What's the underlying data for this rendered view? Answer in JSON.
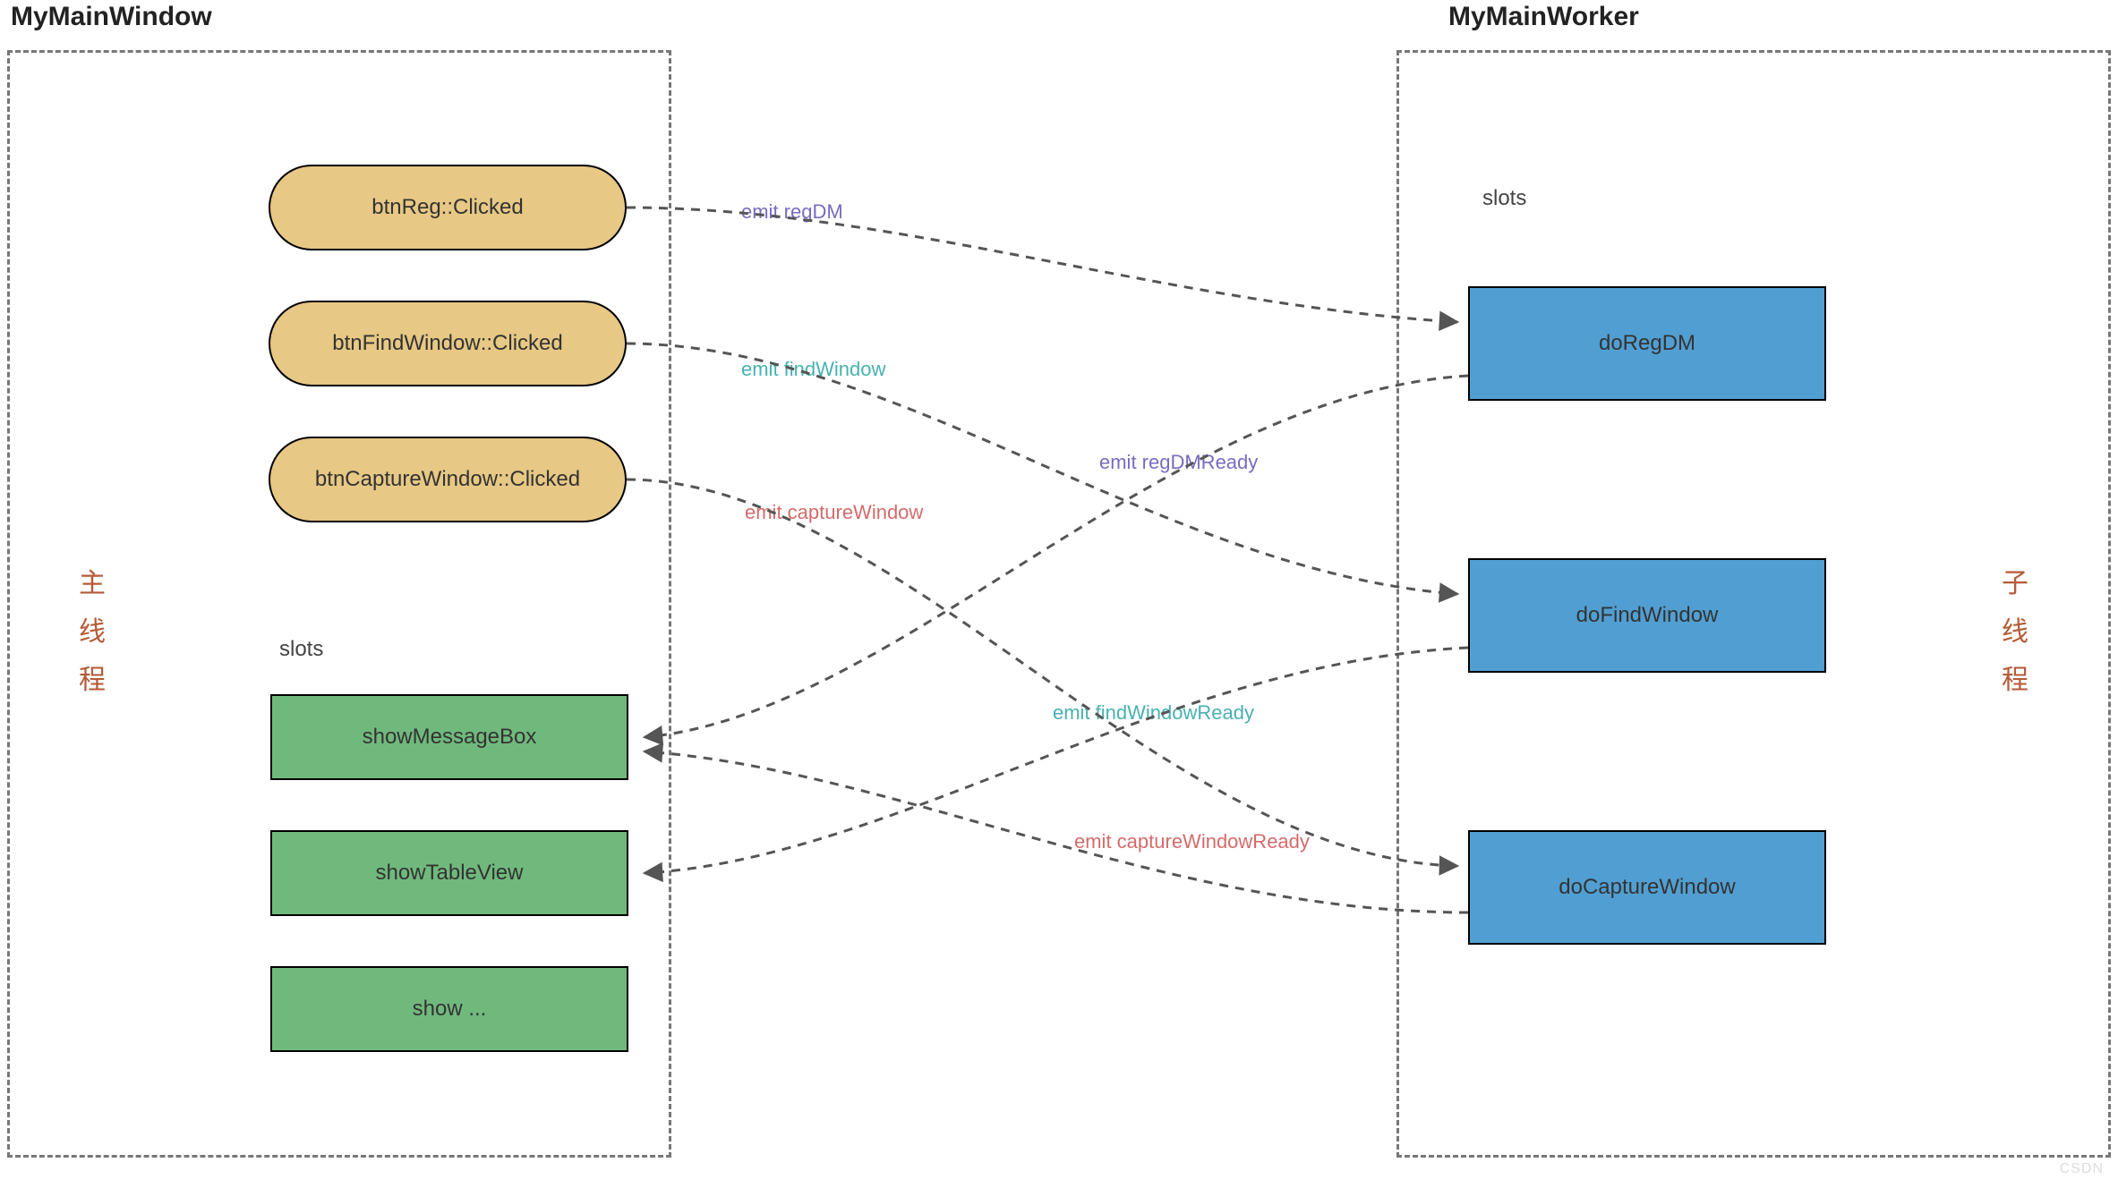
{
  "left": {
    "title": "MyMainWindow",
    "side_label": [
      "主",
      "线",
      "程"
    ],
    "buttons": {
      "btnReg": "btnReg::Clicked",
      "btnFind": "btnFindWindow::Clicked",
      "btnCapture": "btnCaptureWindow::Clicked"
    },
    "slots_label": "slots",
    "slots": {
      "showMessageBox": "showMessageBox",
      "showTableView": "showTableView",
      "showMore": "show ..."
    }
  },
  "right": {
    "title": "MyMainWorker",
    "side_label": [
      "子",
      "线",
      "程"
    ],
    "slots_label": "slots",
    "slots": {
      "doRegDM": "doRegDM",
      "doFindWindow": "doFindWindow",
      "doCaptureWindow": "doCaptureWindow"
    }
  },
  "emits": {
    "regDM": "emit regDM",
    "findWindow": "emit findWindow",
    "captureWindow": "emit captureWindow",
    "regDMReady": "emit regDMReady",
    "findWindowReady": "emit findWindowReady",
    "captureWindowReady": "emit captureWindowReady"
  },
  "colors": {
    "purple": "#7a6bc1",
    "teal": "#49b1b0",
    "salmon": "#d46b6b",
    "pill": "#e7c884",
    "green": "#70b97d",
    "blue": "#519fd2"
  },
  "connections": [
    {
      "from": "btnReg",
      "to": "doRegDM",
      "label": "regDM",
      "color": "purple"
    },
    {
      "from": "btnFind",
      "to": "doFindWindow",
      "label": "findWindow",
      "color": "teal"
    },
    {
      "from": "btnCapture",
      "to": "doCaptureWindow",
      "label": "captureWindow",
      "color": "salmon"
    },
    {
      "from": "doRegDM",
      "to": "showMessageBox",
      "label": "regDMReady",
      "color": "purple"
    },
    {
      "from": "doFindWindow",
      "to": "showTableView",
      "label": "findWindowReady",
      "color": "teal"
    },
    {
      "from": "doCaptureWindow",
      "to": "showMessageBox",
      "label": "captureWindowReady",
      "color": "salmon"
    }
  ]
}
